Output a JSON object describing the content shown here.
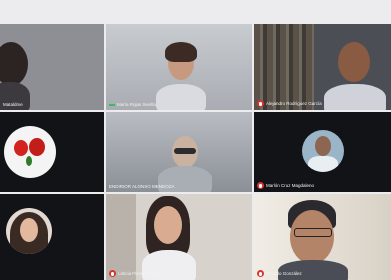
{
  "participants": [
    {
      "name": "Mataldme",
      "muted": false
    },
    {
      "name": "María Rojas Sevilla",
      "muted": false
    },
    {
      "name": "Alejandro Rodríguez García",
      "muted": true
    },
    {
      "name": "",
      "muted": false
    },
    {
      "name": "ENDIRIOR ALONSO MENDOZA",
      "muted": false
    },
    {
      "name": "Marlón Cruz Magdaleno",
      "muted": true
    },
    {
      "name": "",
      "muted": false
    },
    {
      "name": "Leticia Flores Toribio",
      "muted": true
    },
    {
      "name": "Ricardo González",
      "muted": true
    }
  ],
  "colors": {
    "muted_icon": "#d9342b",
    "speaking_indicator": "#36c05a",
    "tile_background": "#2a2d33"
  }
}
